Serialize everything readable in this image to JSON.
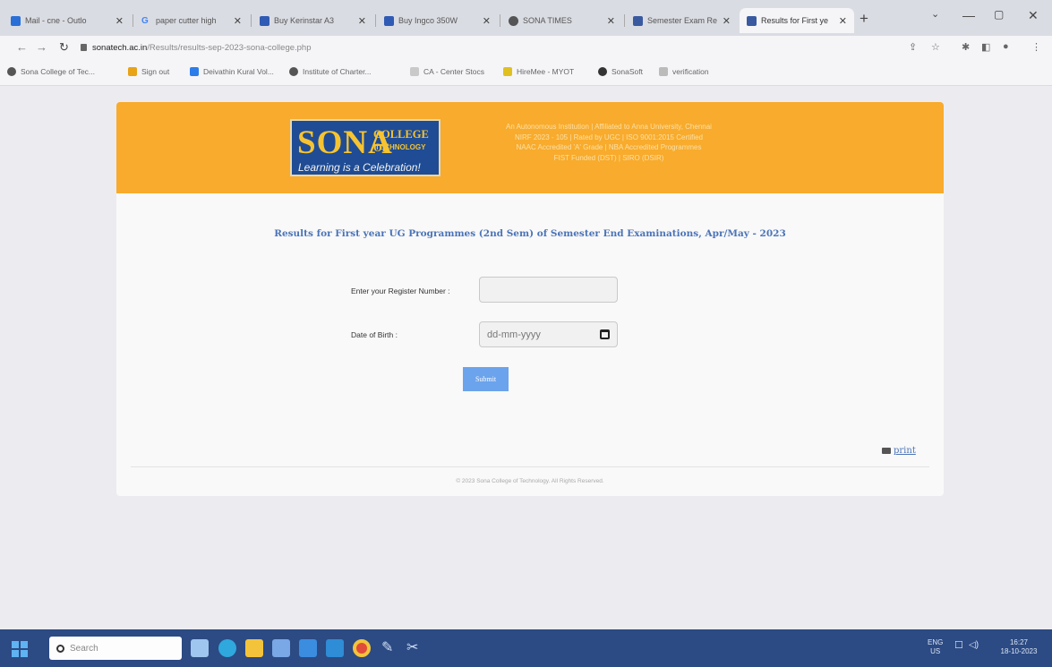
{
  "browser": {
    "tabs": [
      {
        "title": "Mail - cne - Outlo",
        "color": "#2a6fd6"
      },
      {
        "title": "paper cutter high",
        "color": "#4285f4"
      },
      {
        "title": "Buy Kerinstar A3",
        "color": "#2f5bb5"
      },
      {
        "title": "Buy Ingco 350W",
        "color": "#2f5bb5"
      },
      {
        "title": "SONA TIMES",
        "color": "#555555"
      },
      {
        "title": "Semester Exam Re",
        "color": "#3a5aa0"
      },
      {
        "title": "Results for First ye",
        "color": "#3a5aa0"
      }
    ],
    "address": {
      "host": "sonatech.ac.in",
      "path": "/Results/results-sep-2023-sona-college.php"
    },
    "bookmarks": [
      {
        "label": "Sona College of Tec...",
        "color": "#555555"
      },
      {
        "label": "Sign out",
        "color": "#e8a317"
      },
      {
        "label": "Deivathin Kural Vol...",
        "color": "#2b7de9"
      },
      {
        "label": "Institute of Charter...",
        "color": "#555555"
      },
      {
        "label": "CA - Center Stocs",
        "color": "#c9c9c9"
      },
      {
        "label": "HireMee - MYOT",
        "color": "#e0c020"
      },
      {
        "label": "SonaSoft",
        "color": "#333333"
      },
      {
        "label": "verification",
        "color": "#bbbbbb"
      }
    ]
  },
  "banner": {
    "logo_main": "SONA",
    "logo_college": "COLLEGE OF",
    "logo_tech": "TECHNOLOGY",
    "logo_tagline": "Learning is a Celebration!",
    "info_lines": [
      "An Autonomous Institution | Affiliated to Anna University, Chennai",
      "NIRF 2023 - 105 | Rated by UGC | ISO 9001:2015 Certified",
      "NAAC Accredited 'A' Grade | NBA Accredited Programmes",
      "FIST Funded (DST) | SIRO (DSIR)"
    ]
  },
  "form": {
    "heading": "Results for First year UG Programmes (2nd Sem) of Semester End Examinations, Apr/May - 2023",
    "register_label": "Enter your Register Number :",
    "register_value": "",
    "dob_label": "Date of Birth :",
    "dob_placeholder": "dd-mm-yyyy",
    "submit_label": "Submit"
  },
  "print_label": "print",
  "footer_text": "© 2023 Sona College of Technology. All Rights Reserved.",
  "taskbar": {
    "search_placeholder": "Search",
    "lang": "ENG",
    "region": "US",
    "time": "16:27",
    "date": "18-10-2023"
  }
}
